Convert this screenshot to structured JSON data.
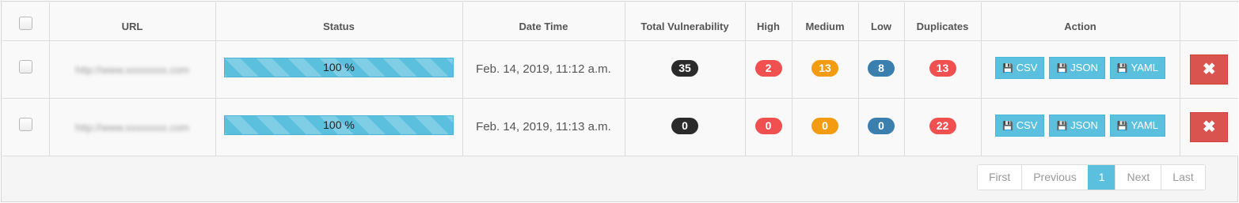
{
  "table": {
    "columns": [
      "",
      "URL",
      "Status",
      "Date Time",
      "Total Vulnerability",
      "High",
      "Medium",
      "Low",
      "Duplicates",
      "Action",
      ""
    ],
    "rows": [
      {
        "url": "http://www.xxxxxxxx.com",
        "status": "100 %",
        "datetime": "Feb. 14, 2019, 11:12 a.m.",
        "total": "35",
        "high": "2",
        "medium": "13",
        "low": "8",
        "duplicates": "13",
        "actions": {
          "csv": "CSV",
          "json": "JSON",
          "yaml": "YAML"
        },
        "delete": "✖"
      },
      {
        "url": "http://www.xxxxxxxx.com",
        "status": "100 %",
        "datetime": "Feb. 14, 2019, 11:13 a.m.",
        "total": "0",
        "high": "0",
        "medium": "0",
        "low": "0",
        "duplicates": "22",
        "actions": {
          "csv": "CSV",
          "json": "JSON",
          "yaml": "YAML"
        },
        "delete": "✖"
      }
    ]
  },
  "pagination": {
    "first": "First",
    "previous": "Previous",
    "current": "1",
    "next": "Next",
    "last": "Last"
  },
  "icons": {
    "download": "floppy-disk-icon",
    "delete": "close-icon"
  },
  "colors": {
    "progress": "#5bc0de",
    "badge_total": "#2b2b2b",
    "badge_high": "#f05050",
    "badge_medium": "#f39c12",
    "badge_low": "#3a7fad",
    "badge_duplicates": "#f05050",
    "action_button": "#5bc0de",
    "delete_button": "#d9534f"
  }
}
